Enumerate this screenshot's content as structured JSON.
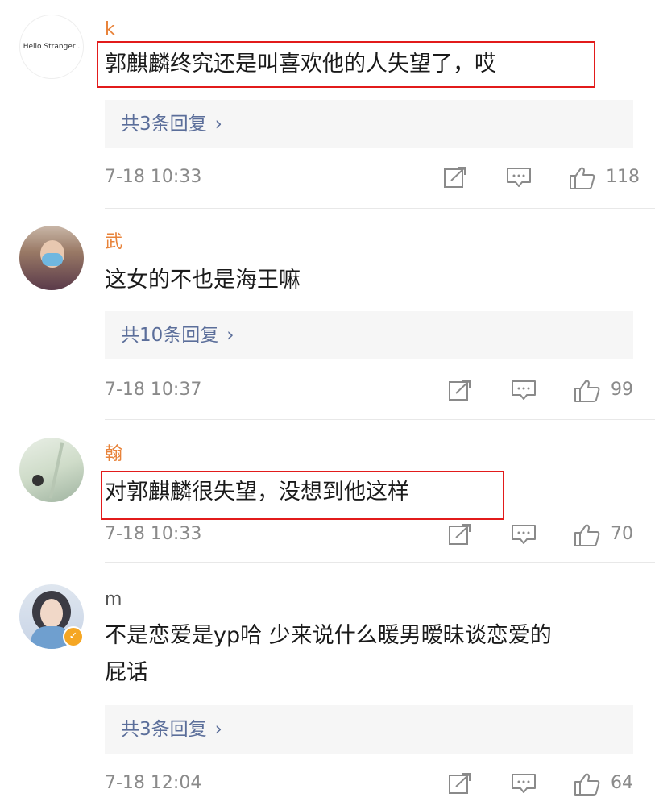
{
  "comments": [
    {
      "username": "k",
      "avatar_text": "Hello Stranger .",
      "text": "郭麒麟终究还是叫喜欢他的人失望了，哎",
      "replies_label": "共3条回复",
      "time": "7-18 10:33",
      "likes": "118"
    },
    {
      "username": "武",
      "text": "这女的不也是海王嘛",
      "replies_label": "共10条回复",
      "time": "7-18 10:37",
      "likes": "99"
    },
    {
      "username": "翰",
      "text": "对郭麒麟很失望，没想到他这样",
      "time": "7-18 10:33",
      "likes": "70"
    },
    {
      "username": "m",
      "text_line1": "不是恋爱是yp哈 少来说什么暖男暧昧谈恋爱的",
      "text_line2": "屁话",
      "replies_label": "共3条回复",
      "time": "7-18 12:04",
      "likes": "64"
    }
  ],
  "icons": {
    "share": "share-icon",
    "comment": "comment-icon",
    "like": "thumbs-up-icon",
    "chevron": "chevron-right-icon",
    "verified": "verified-badge-icon"
  },
  "colors": {
    "username": "#e8833a",
    "reply_link": "#5b6e9a",
    "meta": "#8a8a8a",
    "highlight_box": "#e21b1b",
    "reply_bg": "#f6f6f6"
  }
}
